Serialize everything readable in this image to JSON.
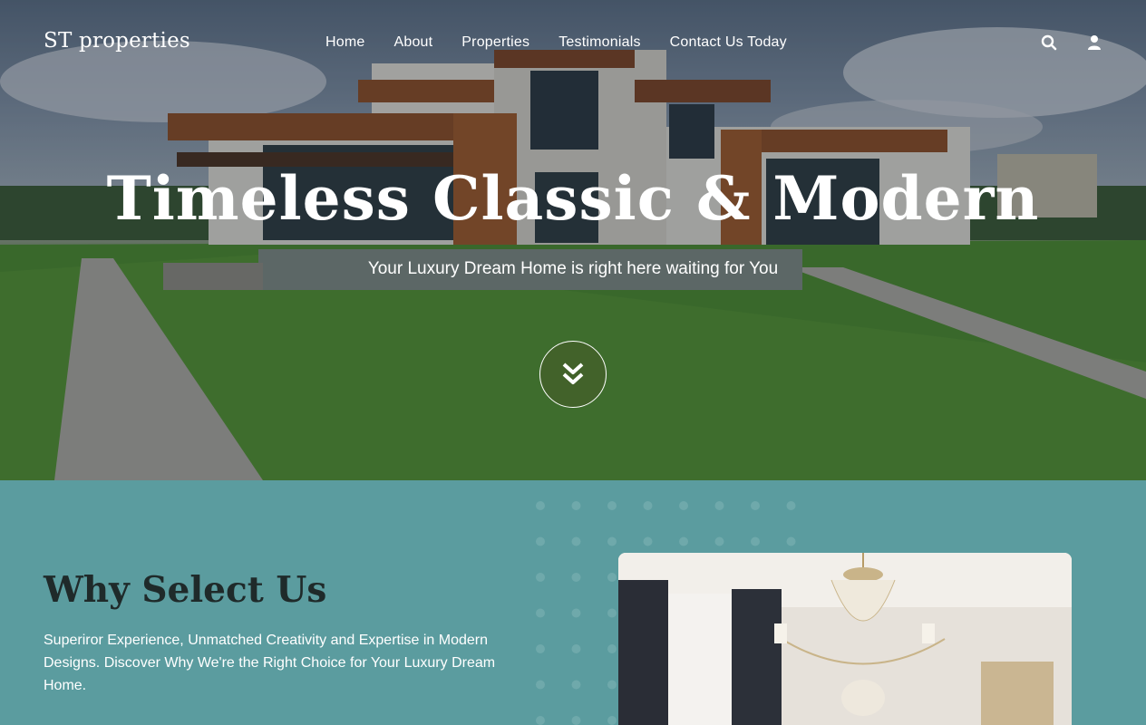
{
  "brand": {
    "logo_text": "ST properties"
  },
  "nav": {
    "items": [
      {
        "label": "Home"
      },
      {
        "label": "About"
      },
      {
        "label": "Properties"
      },
      {
        "label": "Testimonials"
      },
      {
        "label": "Contact Us Today"
      }
    ],
    "icons": [
      "search-icon",
      "user-icon"
    ]
  },
  "hero": {
    "title": "Timeless Classic & Modern",
    "subtitle": "Your Luxury Dream Home is right here waiting for You",
    "scroll_icon": "double-chevron-down-icon"
  },
  "why": {
    "title": "Why Select Us",
    "text": "Superiror Experience, Unmatched Creativity and Expertise in Modern Designs. Discover Why We're the Right Choice for Your Luxury Dream Home."
  },
  "colors": {
    "section_bg": "#5b9c9f",
    "heading_dark": "#1f2a2a",
    "white": "#ffffff"
  }
}
